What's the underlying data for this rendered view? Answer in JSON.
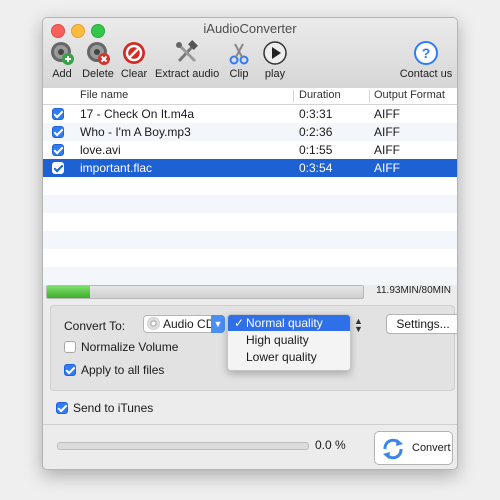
{
  "window": {
    "title": "iAudioConverter"
  },
  "toolbar": {
    "add": "Add",
    "delete": "Delete",
    "clear": "Clear",
    "extract": "Extract audio",
    "clip": "Clip",
    "play": "play",
    "contact": "Contact us"
  },
  "table": {
    "headers": {
      "file_name": "File name",
      "duration": "Duration",
      "output_format": "Output Format"
    },
    "rows": [
      {
        "name": "17 - Check On It.m4a",
        "duration": "0:3:31",
        "format": "AIFF",
        "checked": true
      },
      {
        "name": "Who - I'm A Boy.mp3",
        "duration": "0:2:36",
        "format": "AIFF",
        "checked": true
      },
      {
        "name": "love.avi",
        "duration": "0:1:55",
        "format": "AIFF",
        "checked": true
      },
      {
        "name": "important.flac",
        "duration": "0:3:54",
        "format": "AIFF",
        "checked": true
      }
    ]
  },
  "storage": {
    "text": "11.93MIN/80MIN",
    "fill_fraction": 0.135
  },
  "settings": {
    "convert_to_label": "Convert To:",
    "selected_target": "Audio CD",
    "quality_options": [
      "Normal quality",
      "High quality",
      "Lower quality"
    ],
    "selected_quality": "Normal quality",
    "settings_button": "Settings...",
    "normalize_volume": {
      "label": "Normalize Volume",
      "checked": false
    },
    "apply_all": {
      "label": "Apply to all files",
      "checked": true
    }
  },
  "send_itunes": {
    "label": "Send to iTunes",
    "checked": true
  },
  "conversion": {
    "percent_text": "0.0 %",
    "convert_button": "Convert"
  },
  "colors": {
    "selection": "#1d61d3",
    "progress": "#4dbb3b",
    "accent": "#2f7cf6"
  }
}
